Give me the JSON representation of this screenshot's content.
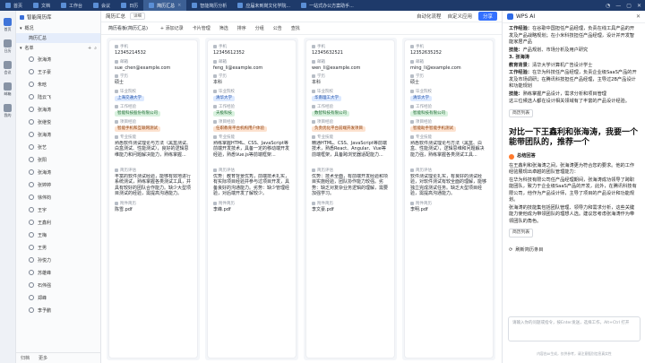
{
  "topbar": {
    "tabs": [
      {
        "label": "首页",
        "active": false
      },
      {
        "label": "文档",
        "active": false
      },
      {
        "label": "工作台",
        "active": false
      },
      {
        "label": "会议",
        "active": false
      },
      {
        "label": "日历",
        "active": false
      },
      {
        "label": "简历汇总",
        "active": true
      },
      {
        "label": "智能简历分析",
        "active": false
      },
      {
        "label": "应届未到岗文化学院...",
        "active": false
      },
      {
        "label": "一站式办公方案助手...",
        "active": false
      }
    ],
    "right_icons": [
      "bell-icon",
      "minimize-icon",
      "maximize-icon",
      "close-icon"
    ]
  },
  "left_rail": [
    {
      "label": "首页",
      "icon": "home-icon"
    },
    {
      "label": "日历",
      "icon": "calendar-icon"
    },
    {
      "label": "会议",
      "icon": "meeting-icon"
    },
    {
      "label": "邮箱",
      "icon": "mail-icon"
    },
    {
      "label": "我的",
      "icon": "user-icon"
    }
  ],
  "sidebar": {
    "app_title": "智能简历库",
    "sections": [
      "概况",
      "简历汇总",
      "名单"
    ],
    "people": [
      "张海涛",
      "王子豪",
      "朱晗",
      "陆云飞",
      "张海涛",
      "张继悦",
      "张海涛",
      "张艺",
      "张阳",
      "张海涛",
      "张婷婷",
      "徐伟钧",
      "王宇",
      "王鑫利",
      "王梅",
      "王男",
      "孙悦力",
      "苏雄峰",
      "石伟强",
      "郑峰",
      "李予鹏"
    ],
    "footer": [
      "归档",
      "更多"
    ]
  },
  "main": {
    "breadcrumb": "简历汇总",
    "breadcrumb_tag": "详细",
    "header_actions": [
      "自动化流程",
      "自定义应用",
      "分享"
    ],
    "toolbar": [
      "简历看板(简历汇总)",
      "+ 添加记录",
      "卡片管理",
      "筛选",
      "排序",
      "分组",
      "公告",
      "查找"
    ],
    "cards": [
      {
        "phone": "12345214532",
        "email": "sue_chen@example.com",
        "education": "硕士",
        "school": "上海交通大学",
        "position": "智能科技股份有限公司",
        "intent": "智能手机和互联网测试",
        "skills": "熟悉软件测试理论与方法（黑盒测试、白盒测试、性能测试），良好的逻辑思维能力和问题解决能力，熟练掌握...",
        "summary": "丰富的软件测试经验，能够有效地进行系统测试，熟练掌握各类测试工具，并具有较好的团队合作能力。缺少大型项目测试的经验，需提高沟通能力。",
        "file": "陈雪.pdf"
      },
      {
        "phone": "12345612352",
        "email": "feng_li@example.com",
        "education": "本科",
        "school": "清华大学",
        "position": "天极科技",
        "intent": "任职教育平台机构用户体验",
        "skills": "熟练掌握HTML、CSS、JavaScript等前端开发技术，具备一定的移动端开发经验，熟悉Vue.js等前端框架...",
        "summary": "优势：教育背景优秀，前端技术扎实，有实际项目经验并参与过项目开发，具备良好的沟通能力。劣势：缺少管理经验，对后端开发了解较少。",
        "file": "李峰.pdf"
      },
      {
        "phone": "12345632521",
        "email": "wen_li@example.com",
        "education": "本科",
        "school": "华南理工大学",
        "position": "数智科技有限公司",
        "intent": "负责优化平台前端开发项目",
        "skills": "精通HTML、CSS、JavaScript等前端技术，熟悉React、Angular、Vue等前端框架，具备跨浏览器适配能力...",
        "summary": "优势：技术全面，有前端开发经验和项目实施经验，团队协作能力较强。劣势：缺乏对复杂业务逻辑的理解，需要加强学习。",
        "file": "李文豪.pdf"
      },
      {
        "phone": "12352635252",
        "email": "ming_li@example.com",
        "education": "硕士",
        "school": "清华大学",
        "position": "智能科技有限公司",
        "intent": "智能助手智能手机测试",
        "skills": "熟悉软件测试理论与方法（黑盒、白盒、性能测试），逻辑思维和问题解决能力强，熟练掌握各类测试工具...",
        "summary": "软件测试理论扎实，有良好的测试经验，对软件测试有较全面的理解，能够独立完成测试任务。缺乏大型项目经验，需提高沟通能力。",
        "file": "李明.pdf"
      }
    ],
    "field_labels": {
      "phone": "手机",
      "email": "邮箱",
      "education": "学历",
      "school": "毕业院校",
      "position": "工作经验",
      "intent": "项目经验",
      "skills": "专业技能",
      "summary": "简历评估",
      "file": "附件简历"
    }
  },
  "ai_panel": {
    "title": "WPS AI",
    "intro_1_label": "工作经验：",
    "intro_1": "在谷歌中国担任产品经理，负责在线工具产品的开发及产品战略规划；在小米科技担任产品经理，设计并开发智能家居产品",
    "intro_2_label": "技能：",
    "intro_2": "产品规划、市场分析及用户研究",
    "person_3": "3. 张海涛",
    "edu_label": "教育背景：",
    "edu": "清华大学计算机广告设计学士",
    "work_label": "工作经验：",
    "work": "在华为科技任产品经理，负责企业级SaaS产品的开发及市场调研；在腾讯科技担任产品经理，主导过2B产品设计和功能规划",
    "skill_label": "技能：",
    "skill": "熟练掌握产品设计，需求分析和项目管理",
    "conclusion": "这三位候选人都在设计相关领域有了丰富的产品设计经验。",
    "outline_btn": "简历列表",
    "question": "对比一下王鑫利和张海涛，我要一个能带团队的，推荐一个",
    "answer_title": "总结回答",
    "answer_p1": "在王鑫利和张海涛之间，张海涛更为符合您的要求。他的工作经验展现出卓越的团队管理能力：",
    "answer_p2": "在华为科技有限公司任产品经理期间，张海涛成功领导了跨职能团队，致力于企业级SaaS产品的开发，此外，在腾讯科技有限公司，他作为产品设计师，主导了项目的产品设计和功能规划。",
    "answer_p3": "张海涛的技能集包括团队管理、领导力和需求分析，这些关键能力使他成为带领团队的理想人选。建议您考虑张海涛作为带领团队的角色。",
    "outline_btn2": "简历列表",
    "refresh": "刷新简历条目",
    "input_placeholder": "请输入你的问题或指令，按Enter发送，选择工作，Alt+Ctrl 打开",
    "footer": "内容由AI生成，仅供参考，请注意甄别信息真实性"
  }
}
